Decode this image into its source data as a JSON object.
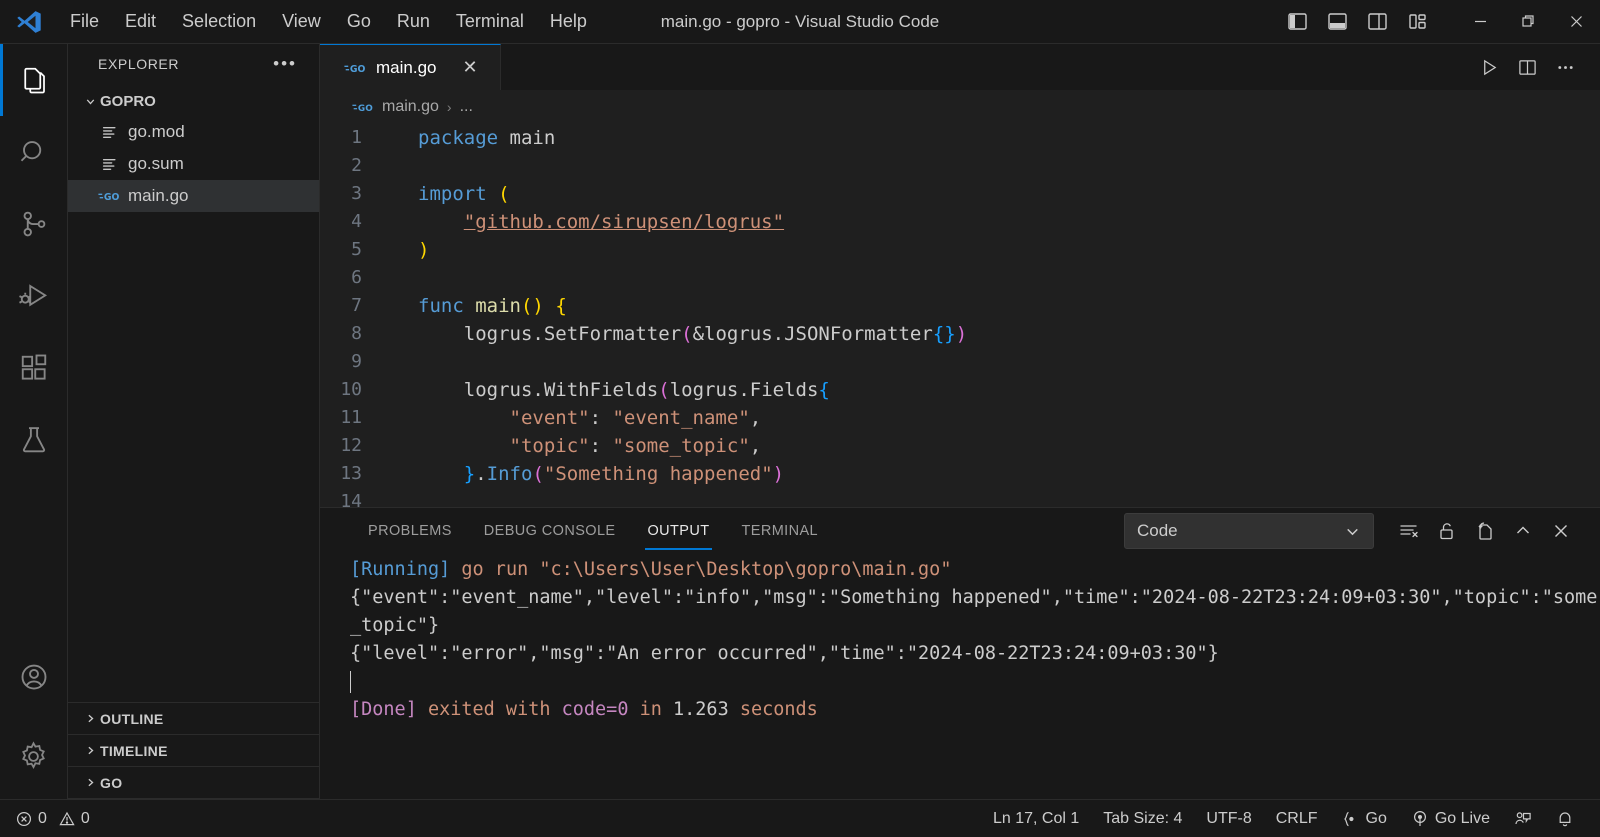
{
  "window": {
    "title": "main.go - gopro - Visual Studio Code",
    "logo": "vscode-logo",
    "menus": [
      "File",
      "Edit",
      "Selection",
      "View",
      "Go",
      "Run",
      "Terminal",
      "Help"
    ],
    "layout_controls": [
      {
        "name": "toggle-primary-sidebar",
        "label": "Toggle Primary Side Bar"
      },
      {
        "name": "toggle-panel",
        "label": "Toggle Panel"
      },
      {
        "name": "toggle-secondary-sidebar",
        "label": "Toggle Secondary Side Bar"
      },
      {
        "name": "customize-layout",
        "label": "Customize Layout"
      }
    ],
    "controls": [
      {
        "name": "minimize-button",
        "glyph": "─"
      },
      {
        "name": "maximize-button",
        "glyph": "❐"
      },
      {
        "name": "close-button",
        "glyph": "✕"
      }
    ]
  },
  "activitybar": {
    "items": [
      {
        "name": "explorer",
        "label": "Explorer",
        "active": true
      },
      {
        "name": "search",
        "label": "Search",
        "active": false
      },
      {
        "name": "source-control",
        "label": "Source Control",
        "active": false
      },
      {
        "name": "run-and-debug",
        "label": "Run and Debug",
        "active": false
      },
      {
        "name": "extensions",
        "label": "Extensions",
        "active": false
      },
      {
        "name": "testing",
        "label": "Testing",
        "active": false
      }
    ],
    "bottom": [
      {
        "name": "accounts",
        "label": "Accounts"
      },
      {
        "name": "settings",
        "label": "Manage"
      }
    ]
  },
  "sidebar": {
    "title": "EXPLORER",
    "more_actions": "•••",
    "root": "GOPRO",
    "files": [
      {
        "name": "go.mod",
        "icon": "text-file-icon",
        "selected": false
      },
      {
        "name": "go.sum",
        "icon": "text-file-icon",
        "selected": false
      },
      {
        "name": "main.go",
        "icon": "go-file-icon",
        "selected": true
      }
    ],
    "panes": [
      "OUTLINE",
      "TIMELINE",
      "GO"
    ]
  },
  "editor": {
    "tab": {
      "label": "main.go",
      "icon": "go-file-icon",
      "close": "✕"
    },
    "actions": [
      {
        "name": "run-code-button",
        "label": "Run Code"
      },
      {
        "name": "split-editor-right-button",
        "label": "Split Editor Right"
      },
      {
        "name": "more-actions-button",
        "label": "More Actions..."
      }
    ],
    "breadcrumb": {
      "file": "main.go",
      "separator": "›",
      "rest": "..."
    },
    "code": [
      {
        "n": "1",
        "tokens": [
          {
            "t": "package ",
            "c": "t-kw"
          },
          {
            "t": "main",
            "c": "t-plain"
          }
        ]
      },
      {
        "n": "2",
        "tokens": []
      },
      {
        "n": "3",
        "tokens": [
          {
            "t": "import ",
            "c": "t-kw"
          },
          {
            "t": "(",
            "c": "t-brace"
          }
        ]
      },
      {
        "n": "4",
        "tokens": [
          {
            "t": "    ",
            "c": "t-plain"
          },
          {
            "t": "\"github.com/sirupsen/logrus\"",
            "c": "t-link"
          }
        ]
      },
      {
        "n": "5",
        "tokens": [
          {
            "t": ")",
            "c": "t-brace"
          }
        ]
      },
      {
        "n": "6",
        "tokens": []
      },
      {
        "n": "7",
        "tokens": [
          {
            "t": "func ",
            "c": "t-kw"
          },
          {
            "t": "main",
            "c": "t-fn"
          },
          {
            "t": "()",
            "c": "t-brace"
          },
          {
            "t": " ",
            "c": "t-plain"
          },
          {
            "t": "{",
            "c": "t-brace"
          }
        ]
      },
      {
        "n": "8",
        "tokens": [
          {
            "t": "    ",
            "c": "t-plain"
          },
          {
            "t": "logrus",
            "c": "t-plain"
          },
          {
            "t": ".",
            "c": "t-plain"
          },
          {
            "t": "SetFormatter",
            "c": "t-plain"
          },
          {
            "t": "(",
            "c": "t-paren"
          },
          {
            "t": "&logrus.JSONFormatter",
            "c": "t-plain"
          },
          {
            "t": "{}",
            "c": "t-brace2"
          },
          {
            "t": ")",
            "c": "t-paren"
          }
        ]
      },
      {
        "n": "9",
        "tokens": []
      },
      {
        "n": "10",
        "tokens": [
          {
            "t": "    ",
            "c": "t-plain"
          },
          {
            "t": "logrus.WithFields",
            "c": "t-plain"
          },
          {
            "t": "(",
            "c": "t-paren"
          },
          {
            "t": "logrus.Fields",
            "c": "t-plain"
          },
          {
            "t": "{",
            "c": "t-brace2"
          }
        ]
      },
      {
        "n": "11",
        "tokens": [
          {
            "t": "        ",
            "c": "t-plain"
          },
          {
            "t": "\"event\"",
            "c": "t-str"
          },
          {
            "t": ": ",
            "c": "t-plain"
          },
          {
            "t": "\"event_name\"",
            "c": "t-str"
          },
          {
            "t": ",",
            "c": "t-plain"
          }
        ]
      },
      {
        "n": "12",
        "tokens": [
          {
            "t": "        ",
            "c": "t-plain"
          },
          {
            "t": "\"topic\"",
            "c": "t-str"
          },
          {
            "t": ": ",
            "c": "t-plain"
          },
          {
            "t": "\"some_topic\"",
            "c": "t-str"
          },
          {
            "t": ",",
            "c": "t-plain"
          }
        ]
      },
      {
        "n": "13",
        "tokens": [
          {
            "t": "    ",
            "c": "t-plain"
          },
          {
            "t": "}",
            "c": "t-brace2"
          },
          {
            "t": ".",
            "c": "t-plain"
          },
          {
            "t": "Info",
            "c": "t-kw"
          },
          {
            "t": "(",
            "c": "t-paren"
          },
          {
            "t": "\"Something happened\"",
            "c": "t-str"
          },
          {
            "t": ")",
            "c": "t-paren"
          }
        ]
      },
      {
        "n": "14",
        "tokens": []
      }
    ]
  },
  "panel": {
    "tabs": [
      {
        "label": "PROBLEMS",
        "active": false
      },
      {
        "label": "DEBUG CONSOLE",
        "active": false
      },
      {
        "label": "OUTPUT",
        "active": true
      },
      {
        "label": "TERMINAL",
        "active": false
      }
    ],
    "channel": "Code",
    "channel_chevron": "⌄",
    "actions": [
      {
        "name": "clear-output-button",
        "label": "Clear Output"
      },
      {
        "name": "turn-auto-scrolling-off-button",
        "label": "Turn Auto Scrolling Off"
      },
      {
        "name": "open-output-in-editor-button",
        "label": "Open Output in Editor"
      },
      {
        "name": "maximize-panel-size-button",
        "label": "Maximize Panel Size"
      },
      {
        "name": "close-panel-button",
        "label": "Close Panel"
      }
    ],
    "output": [
      {
        "segments": [
          {
            "t": "[Running] ",
            "c": "o-blue"
          },
          {
            "t": "go run ",
            "c": "o-str"
          },
          {
            "t": "\"c:\\Users\\User\\Desktop\\gopro\\main.go\"",
            "c": "o-str"
          }
        ]
      },
      {
        "segments": [
          {
            "t": "{\"event\":\"event_name\",\"level\":\"info\",\"msg\":\"Something happened\",\"time\":\"2024-08-22T23:24:09+03:30\",\"topic\":\"some_topic\"}",
            "c": "o-white"
          }
        ]
      },
      {
        "segments": [
          {
            "t": "{\"level\":\"error\",\"msg\":\"An error occurred\",\"time\":\"2024-08-22T23:24:09+03:30\"}",
            "c": "o-white"
          }
        ]
      },
      {
        "segments": [
          {
            "t": "",
            "c": "o-white"
          }
        ]
      },
      {
        "segments": [
          {
            "t": "[Done] ",
            "c": "o-mag"
          },
          {
            "t": "exited with ",
            "c": "o-str"
          },
          {
            "t": "code=0",
            "c": "o-mag"
          },
          {
            "t": " in ",
            "c": "o-str"
          },
          {
            "t": "1.263",
            "c": "o-white"
          },
          {
            "t": " seconds",
            "c": "o-str"
          }
        ]
      }
    ]
  },
  "statusbar": {
    "errors": "0",
    "warnings": "0",
    "position": "Ln 17, Col 1",
    "tabsize": "Tab Size: 4",
    "encoding": "UTF-8",
    "eol": "CRLF",
    "language": "Go",
    "golive": "Go Live",
    "remote_icon": "remote-window-icon",
    "bell_icon": "notifications-bell-icon"
  },
  "colors": {
    "accent": "#0078d4",
    "editor_bg": "#1f1f1f",
    "chrome_bg": "#181818",
    "text": "#cccccc"
  }
}
